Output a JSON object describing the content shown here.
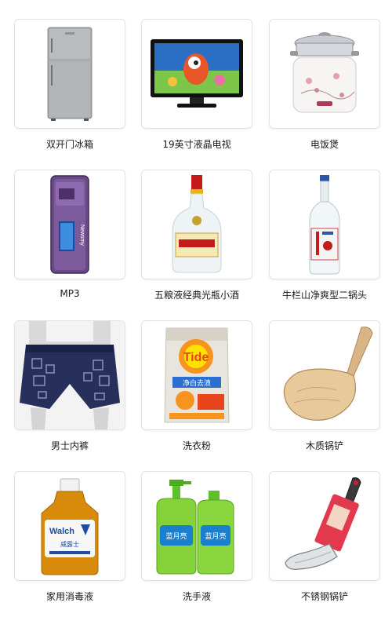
{
  "products": [
    {
      "label": "双开门冰箱",
      "icon": "refrigerator-icon"
    },
    {
      "label": "19英寸液晶电视",
      "icon": "lcd-tv-icon"
    },
    {
      "label": "电饭煲",
      "icon": "rice-cooker-icon"
    },
    {
      "label": "MP3",
      "icon": "mp3-player-icon"
    },
    {
      "label": "五粮液经典光瓶小酒",
      "icon": "liquor-bottle-icon"
    },
    {
      "label": "牛栏山净爽型二锅头",
      "icon": "erguotou-bottle-icon"
    },
    {
      "label": "男士内裤",
      "icon": "men-underwear-icon"
    },
    {
      "label": "洗衣粉",
      "icon": "laundry-detergent-icon"
    },
    {
      "label": "木质锅铲",
      "icon": "wooden-spatula-icon"
    },
    {
      "label": "家用消毒液",
      "icon": "disinfectant-bottle-icon"
    },
    {
      "label": "洗手液",
      "icon": "hand-soap-icon"
    },
    {
      "label": "不锈钢锅铲",
      "icon": "steel-spatula-icon"
    }
  ],
  "brand_text": {
    "mp3": "Newsmy",
    "tide_logo": "Tide",
    "tide_sub": "净白去渍",
    "walch": "Walch",
    "walch_sub": "威露士",
    "lanyueliang": "蓝月亮"
  }
}
